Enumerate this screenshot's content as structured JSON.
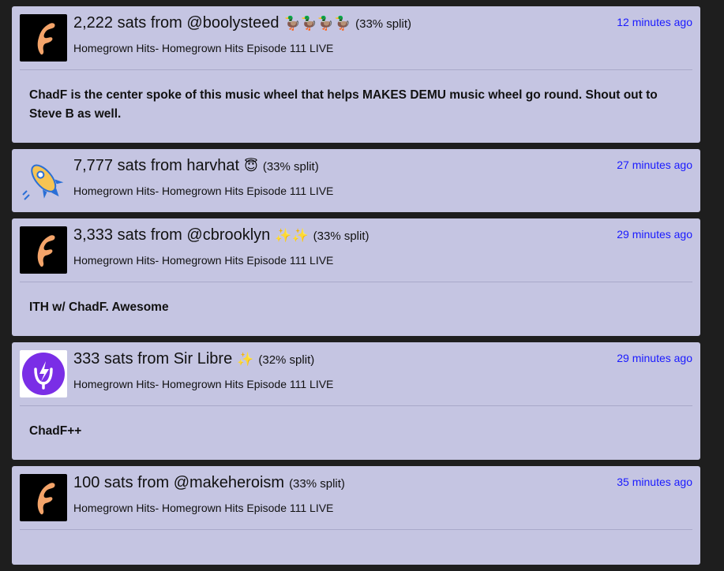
{
  "boosts": [
    {
      "avatar": "fountain-logo",
      "amount_text": "2,222 sats from @boolysteed",
      "emoji": "🦆🦆🦆🦆",
      "split": "(33% split)",
      "episode": "Homegrown Hits- Homegrown Hits Episode 111 LIVE",
      "time": "12 minutes ago",
      "message": "ChadF is the center spoke of this music wheel that helps MAKES DEMU music wheel go round. Shout out to Steve B as well."
    },
    {
      "avatar": "rocket",
      "amount_text": "7,777 sats from harvhat",
      "emoji": "😇",
      "split": "(33% split)",
      "episode": "Homegrown Hits- Homegrown Hits Episode 111 LIVE",
      "time": "27 minutes ago",
      "message": ""
    },
    {
      "avatar": "fountain-logo",
      "amount_text": "3,333 sats from @cbrooklyn",
      "emoji": "✨✨",
      "split": "(33% split)",
      "episode": "Homegrown Hits- Homegrown Hits Episode 111 LIVE",
      "time": "29 minutes ago",
      "message": "ITH w/ ChadF. Awesome"
    },
    {
      "avatar": "lightning-mic",
      "amount_text": "333 sats from Sir Libre",
      "emoji": "✨",
      "split": "(32% split)",
      "episode": "Homegrown Hits- Homegrown Hits Episode 111 LIVE",
      "time": "29 minutes ago",
      "message": "ChadF++"
    },
    {
      "avatar": "fountain-logo",
      "amount_text": "100 sats from @makeheroism",
      "emoji": "",
      "split": "(33% split)",
      "episode": "Homegrown Hits- Homegrown Hits Episode 111 LIVE",
      "time": "35 minutes ago",
      "message": ""
    }
  ],
  "colors": {
    "card_bg": "#c5c5e2",
    "page_bg": "#1e1e1e",
    "link": "#1a1aff",
    "fountain_orange": "#f4a46a"
  }
}
